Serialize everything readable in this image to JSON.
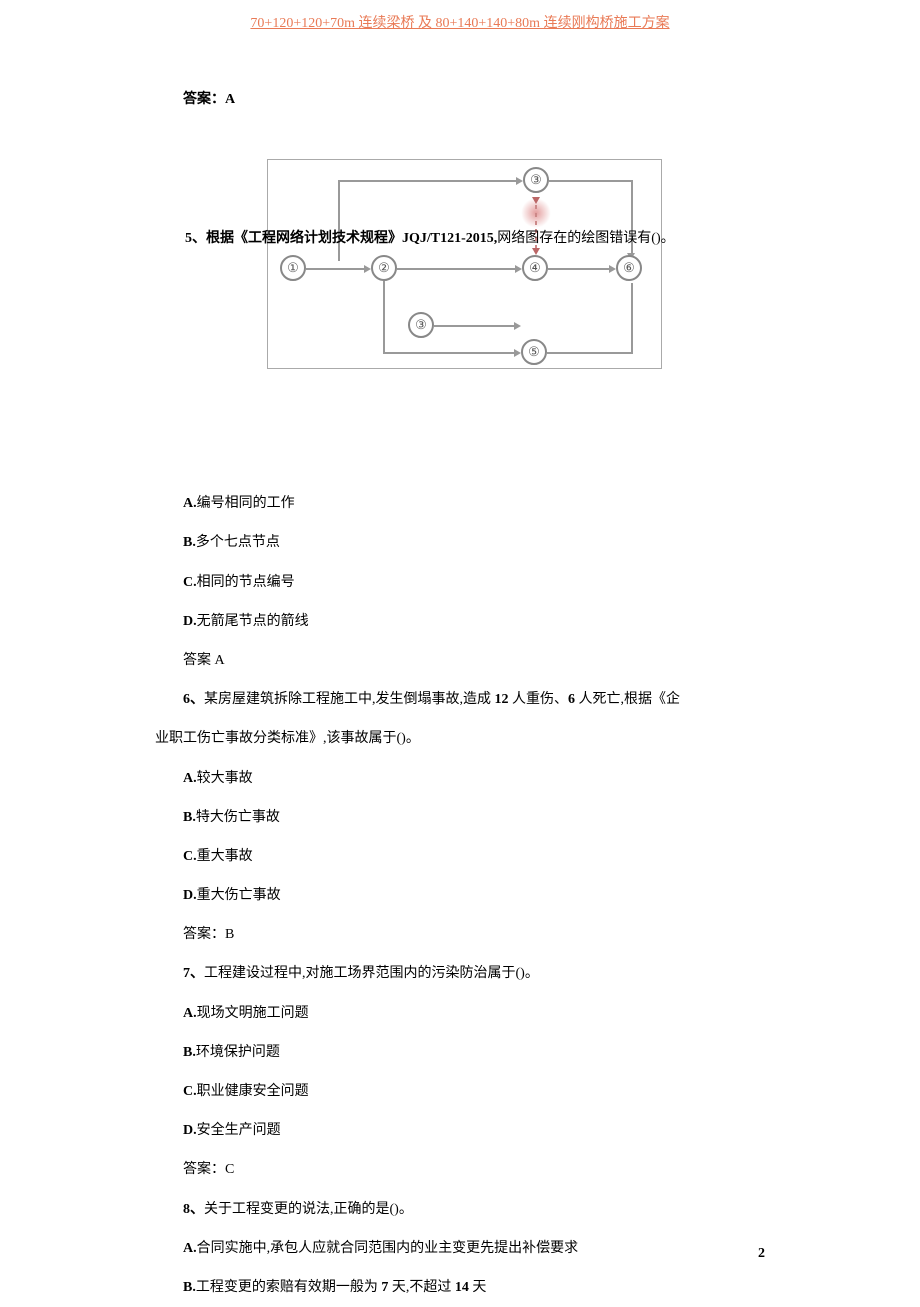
{
  "header": {
    "link_text": "70+120+120+70m 连续梁桥 及 80+140+140+80m 连续刚构桥施工方案"
  },
  "answer_4": "答案：A",
  "q5": {
    "prefix": "5、根据《工程网络计划技术规程》",
    "spec": "JQJ/T121-2015,",
    "suffix": "网络图存在的绘图错误有()。",
    "nodes": {
      "n1": "①",
      "n2": "②",
      "n3": "③",
      "n4": "④",
      "n5": "⑤",
      "n6": "⑥",
      "n3b": "③"
    },
    "options": {
      "a_prefix": "A.",
      "a_text": "编号相同的工作",
      "b_prefix": "B.",
      "b_text": "多个七点节点",
      "c_prefix": "C.",
      "c_text": "相同的节点编号",
      "d_prefix": "D.",
      "d_text": "无箭尾节点的箭线"
    },
    "answer": "答案 A"
  },
  "q6": {
    "line1_prefix": "6、",
    "line1_text_a": "某房屋建筑拆除工程施工中,发生倒塌事故,造成 ",
    "line1_num_a": "12",
    "line1_text_b": " 人重伤、",
    "line1_num_b": "6",
    "line1_text_c": " 人死亡,根据《企",
    "line2": "业职工伤亡事故分类标准》,该事故属于()。",
    "options": {
      "a_prefix": "A.",
      "a_text": "较大事故",
      "b_prefix": "B.",
      "b_text": "特大伤亡事故",
      "c_prefix": "C.",
      "c_text": "重大事故",
      "d_prefix": "D.",
      "d_text": "重大伤亡事故"
    },
    "answer": "答案：B"
  },
  "q7": {
    "prefix": "7、",
    "text": "工程建设过程中,对施工场界范围内的污染防治属于()。",
    "options": {
      "a_prefix": "A.",
      "a_text": "现场文明施工问题",
      "b_prefix": "B.",
      "b_text": "环境保护问题",
      "c_prefix": "C.",
      "c_text": "职业健康安全问题",
      "d_prefix": "D.",
      "d_text": "安全生产问题"
    },
    "answer": "答案：C"
  },
  "q8": {
    "prefix": "8、",
    "text": "关于工程变更的说法,正确的是()。",
    "options": {
      "a_prefix": "A.",
      "a_text": "合同实施中,承包人应就合同范围内的业主变更先提出补偿要求",
      "b_prefix": "B.",
      "b_text_a": "工程变更的索赔有效期一般为 ",
      "b_num_a": "7",
      "b_text_b": " 天,不超过 ",
      "b_num_b": "14",
      "b_text_c": " 天"
    }
  },
  "page_number": "2"
}
